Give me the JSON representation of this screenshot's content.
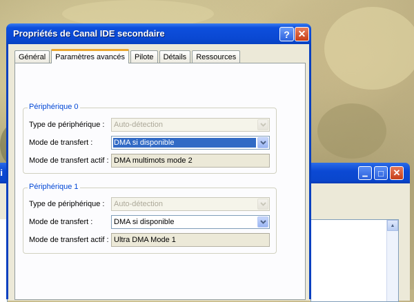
{
  "dialog": {
    "title": "Propriétés de Canal IDE secondaire",
    "help_button": "?",
    "close_button": "✕",
    "tabs": [
      {
        "label": "Général",
        "active": false
      },
      {
        "label": "Paramètres avancés",
        "active": true
      },
      {
        "label": "Pilote",
        "active": false
      },
      {
        "label": "Détails",
        "active": false
      },
      {
        "label": "Ressources",
        "active": false
      }
    ],
    "device0": {
      "legend": "Périphérique 0",
      "type_label": "Type de périphérique :",
      "type_value": "Auto-détection",
      "transfer_label": "Mode de transfert :",
      "transfer_value": "DMA si disponible",
      "active_label": "Mode de transfert actif :",
      "active_value": "DMA multimots mode 2"
    },
    "device1": {
      "legend": "Périphérique 1",
      "type_label": "Type de périphérique :",
      "type_value": "Auto-détection",
      "transfer_label": "Mode de transfert :",
      "transfer_value": "DMA si disponible",
      "active_label": "Mode de transfert actif :",
      "active_value": "Ultra DMA Mode 1"
    }
  },
  "background_window": {
    "title_fragment": "ti",
    "minimize": "▁",
    "maximize": "□",
    "close": "✕"
  },
  "colors": {
    "title_bar": "#0a46cc",
    "legend_text": "#0046d5",
    "selection": "#316ac5",
    "active_tab_accent": "#ffc83c",
    "dialog_face": "#ece9d8"
  }
}
